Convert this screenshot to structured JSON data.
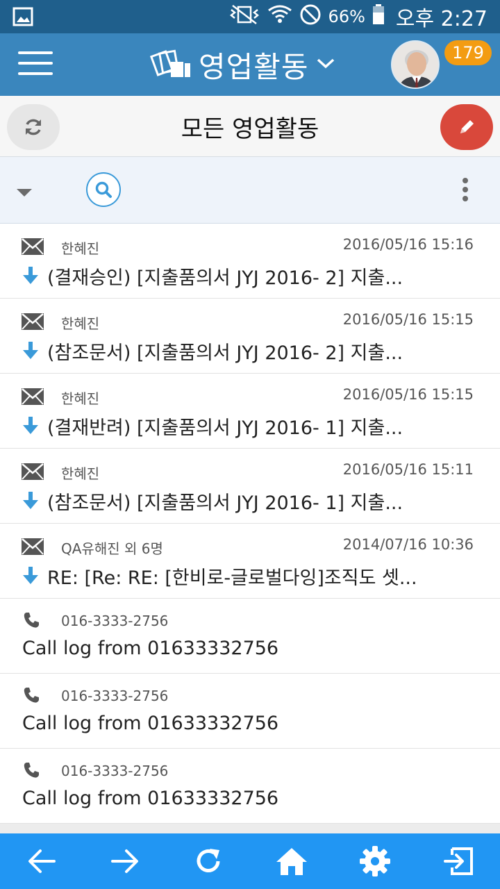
{
  "status_bar": {
    "battery": "66%",
    "time": "오후 2:27"
  },
  "app_bar": {
    "title": "영업활동",
    "notification_count": "179"
  },
  "sub_header": {
    "title": "모든 영업활동"
  },
  "activities": [
    {
      "type": "email",
      "icon": "envelope-icon",
      "sender": "한혜진",
      "date": "2016/05/16 15:16",
      "subject": "(결재승인) [지출품의서 JYJ 2016- 2] 지출..."
    },
    {
      "type": "email",
      "icon": "envelope-icon",
      "sender": "한혜진",
      "date": "2016/05/16 15:15",
      "subject": "(참조문서) [지출품의서 JYJ 2016- 2] 지출..."
    },
    {
      "type": "email",
      "icon": "envelope-icon",
      "sender": "한혜진",
      "date": "2016/05/16 15:15",
      "subject": "(결재반려) [지출품의서 JYJ 2016- 1] 지출..."
    },
    {
      "type": "email",
      "icon": "envelope-icon",
      "sender": "한혜진",
      "date": "2016/05/16 15:11",
      "subject": "(참조문서) [지출품의서 JYJ 2016- 1] 지출..."
    },
    {
      "type": "email",
      "icon": "envelope-icon",
      "sender": "QA유해진 외 6명",
      "date": "2014/07/16 10:36",
      "subject": "RE: [Re: RE: [한비로-글로벌다잉]조직도 셋..."
    },
    {
      "type": "call",
      "icon": "phone-icon",
      "sender": "016-3333-2756",
      "date": "",
      "subject": "Call log from 01633332756"
    },
    {
      "type": "call",
      "icon": "phone-icon",
      "sender": "016-3333-2756",
      "date": "",
      "subject": "Call log from 01633332756"
    },
    {
      "type": "call",
      "icon": "phone-icon",
      "sender": "016-3333-2756",
      "date": "",
      "subject": "Call log from 01633332756"
    }
  ],
  "bottom_nav": [
    "back-arrow-icon",
    "forward-arrow-icon",
    "reload-icon",
    "home-icon",
    "gear-icon",
    "logout-icon"
  ],
  "colors": {
    "status_bar": "#1f5f8c",
    "app_bar": "#3a86bd",
    "compose": "#d9483b",
    "badge": "#f39c12",
    "bottom_nav": "#2196f3",
    "incoming_arrow": "#3a9ad9"
  }
}
